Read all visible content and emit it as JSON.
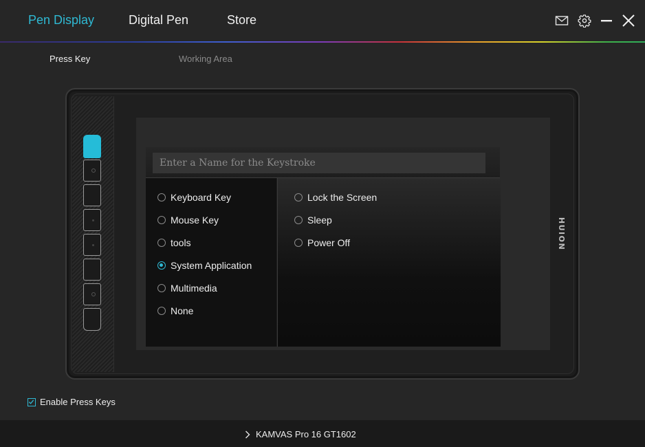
{
  "header": {
    "tabs": [
      {
        "label": "Pen Display",
        "active": true
      },
      {
        "label": "Digital Pen",
        "active": false
      },
      {
        "label": "Store",
        "active": false
      }
    ],
    "icons": [
      "mail-icon",
      "gear-icon",
      "minimize-icon",
      "close-icon"
    ],
    "accent_color": "#2fb9d3"
  },
  "subtabs": [
    {
      "label": "Press Key",
      "active": true
    },
    {
      "label": "Working Area",
      "active": false
    }
  ],
  "tablet": {
    "brand": "HUION",
    "press_keys_count": 8,
    "selected_key_index": 0,
    "selected_key_color": "#25bcd8"
  },
  "keystroke_panel": {
    "name_placeholder": "Enter a Name for the Keystroke",
    "name_value": "",
    "categories": [
      {
        "label": "Keyboard Key",
        "selected": false
      },
      {
        "label": "Mouse Key",
        "selected": false
      },
      {
        "label": "tools",
        "selected": false
      },
      {
        "label": "System Application",
        "selected": true
      },
      {
        "label": "Multimedia",
        "selected": false
      },
      {
        "label": "None",
        "selected": false
      }
    ],
    "actions": [
      {
        "label": "Lock the Screen",
        "selected": false
      },
      {
        "label": "Sleep",
        "selected": false
      },
      {
        "label": "Power Off",
        "selected": false
      }
    ]
  },
  "enable_press_keys": {
    "label": "Enable Press Keys",
    "checked": true
  },
  "footer": {
    "device_name": "KAMVAS Pro 16 GT1602"
  }
}
